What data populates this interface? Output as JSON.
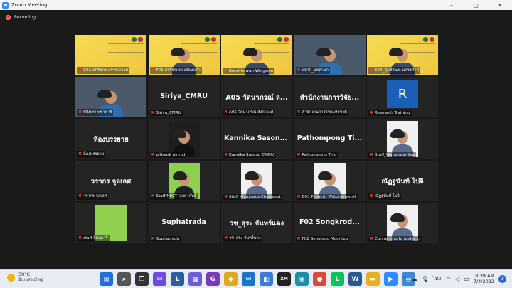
{
  "window": {
    "title": "Zoom Meeting",
    "controls": [
      "–",
      "▢",
      "✕"
    ]
  },
  "recording": {
    "label": "Recording"
  },
  "tiles": [
    {
      "kind": "slide",
      "name": "C02 อภิรัชกร สุรุฑนวิจอม"
    },
    {
      "kind": "slide-person",
      "name": "F01 อัจรีรณ ทองสอนแก้ว"
    },
    {
      "kind": "slide-person",
      "name": "Boonthawan Wingwon"
    },
    {
      "kind": "video",
      "name": "แม่ไก่_นหลาบก"
    },
    {
      "kind": "slide-person",
      "name": "E04_ศุภชีวัฒน์ นครงคำดี"
    },
    {
      "kind": "video",
      "name": "ชนินทร์ พชาพารี"
    },
    {
      "kind": "text",
      "big": "Siriya_CMRU",
      "name": "Siriya_CMRU"
    },
    {
      "kind": "text",
      "big": "A05 วัดนาภรณ์ ล...",
      "name": "A05 วัดนาภรณ์ สังกาวงศ์"
    },
    {
      "kind": "text",
      "big": "สำนักงานการวิจัย...",
      "name": "สำนักงานการวิจัยแห่งชาติ"
    },
    {
      "kind": "avatar",
      "letter": "R",
      "name": "Research Training"
    },
    {
      "kind": "text",
      "big": "ห้องบรรยาย",
      "name": "ห้องบรรยาย"
    },
    {
      "kind": "photo",
      "name": "pitipark pinrod"
    },
    {
      "kind": "text",
      "big": "Kannika Sasong ...",
      "name": "Kannika Sasong CMRU"
    },
    {
      "kind": "text",
      "big": "Pathompong Ti...",
      "name": "Pathompong Tino"
    },
    {
      "kind": "photo-light",
      "name": "Staff_Waneewanliya"
    },
    {
      "kind": "text",
      "big": "วรากร จุลเลศ",
      "name": "วรากร จุลเลศ"
    },
    {
      "kind": "green-photo",
      "name": "Staff NRCT_กุลยาภัทร์"
    },
    {
      "kind": "photo-light",
      "name": "Staff Khontaros Chaiyasut"
    },
    {
      "kind": "photo-light",
      "name": "B03.Pollakrit Watcharawisit"
    },
    {
      "kind": "text",
      "big": "ณัฏฐนันท์ ไปจิ",
      "name": "ณัฏฐนันท์ ไปจิ"
    },
    {
      "kind": "green",
      "name": "staff อินสุดารี"
    },
    {
      "kind": "text",
      "big": "Suphatrada",
      "name": "Suphatrada"
    },
    {
      "kind": "text",
      "big": "วช_สุระ จันทร์แดง",
      "name": "วช_สุระ จันทร์แดง"
    },
    {
      "kind": "text",
      "big": "F02 Songkrod...",
      "name": "F02 Songkrod Moontep"
    },
    {
      "kind": "photo-light",
      "name": "Connecting to audio ..."
    }
  ],
  "taskbar": {
    "weather": {
      "temp": "30°C",
      "condition": "มีเมฆส่วนใหญ่"
    },
    "apps": [
      {
        "icon": "windows-start-icon",
        "glyph": "⊞",
        "color": "#1f6fe0"
      },
      {
        "icon": "search-icon",
        "glyph": "⌕",
        "color": "#555555"
      },
      {
        "icon": "task-view-icon",
        "glyph": "❐",
        "color": "#333333"
      },
      {
        "icon": "chat-icon",
        "glyph": "✉",
        "color": "#6a4ce0"
      },
      {
        "icon": "l-app-icon",
        "glyph": "L",
        "color": "#2a5fa8"
      },
      {
        "icon": "calendar-app-icon",
        "glyph": "▦",
        "color": "#6b5ed6"
      },
      {
        "icon": "g-app-icon",
        "glyph": "G",
        "color": "#7a3ab8"
      },
      {
        "icon": "paint-app-icon",
        "glyph": "◆",
        "color": "#e0a81c"
      },
      {
        "icon": "mail-app-icon",
        "glyph": "✉",
        "color": "#1a73c9"
      },
      {
        "icon": "store-app-icon",
        "glyph": "◧",
        "color": "#3b7bdc"
      },
      {
        "icon": "xm-app-icon",
        "glyph": "XM",
        "color": "#222222"
      },
      {
        "icon": "edge-icon",
        "glyph": "◉",
        "color": "#1e8fa8"
      },
      {
        "icon": "chrome-icon",
        "glyph": "●",
        "color": "#d94a3b"
      },
      {
        "icon": "line-icon",
        "glyph": "L",
        "color": "#06c755"
      },
      {
        "icon": "word-icon",
        "glyph": "W",
        "color": "#2b5797"
      },
      {
        "icon": "file-explorer-icon",
        "glyph": "▬",
        "color": "#e8b020"
      },
      {
        "icon": "zoom-taskbar-icon",
        "glyph": "▶",
        "color": "#2d8cff"
      },
      {
        "icon": "cisco-icon",
        "glyph": "◎",
        "color": "#3a8ad8"
      }
    ],
    "language": "ไทย",
    "time": "8:39 AM",
    "date": "7/4/2022",
    "notifications": "1"
  }
}
